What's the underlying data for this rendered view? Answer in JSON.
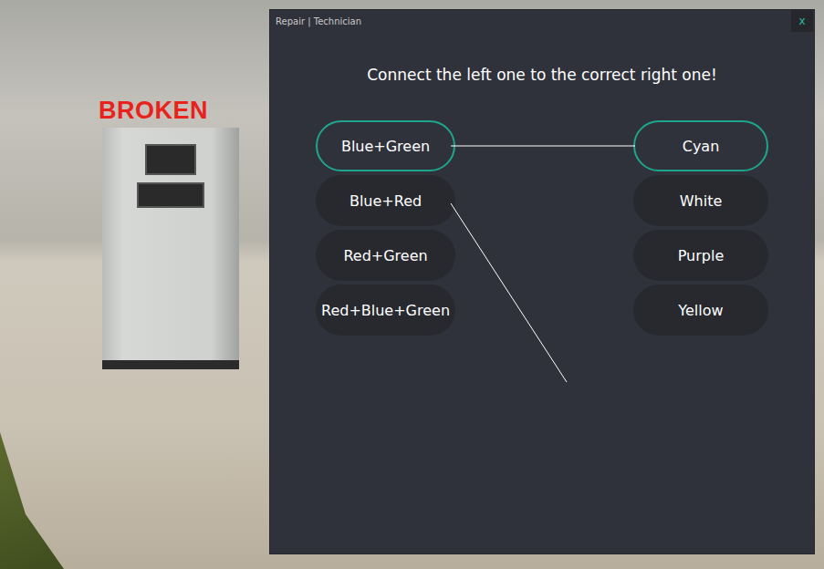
{
  "window": {
    "title": "Repair | Technician",
    "close": "x"
  },
  "scene": {
    "label": "BROKEN"
  },
  "prompt": "Connect the left one to the correct right one!",
  "left": [
    {
      "label": "Blue+Green",
      "selected": true
    },
    {
      "label": "Blue+Red",
      "selected": false
    },
    {
      "label": "Red+Green",
      "selected": false
    },
    {
      "label": "Red+Blue+Green",
      "selected": false
    }
  ],
  "right": [
    {
      "label": "Cyan",
      "selected": true
    },
    {
      "label": "White",
      "selected": false
    },
    {
      "label": "Purple",
      "selected": false
    },
    {
      "label": "Yellow",
      "selected": false
    }
  ],
  "connections": [
    {
      "from": 0,
      "to": 0
    }
  ],
  "dragging": {
    "from": 1
  }
}
